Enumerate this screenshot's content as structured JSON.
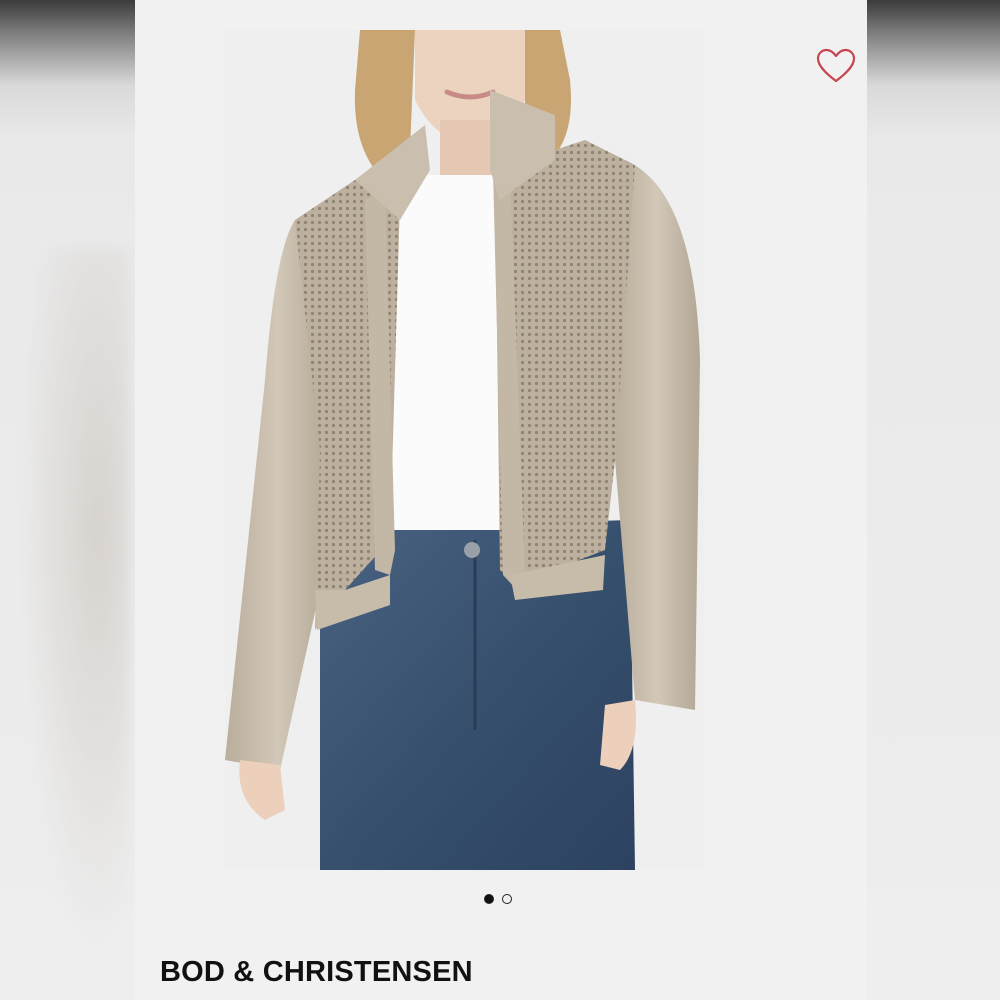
{
  "product": {
    "brand": "BOD & CHRISTENSEN",
    "image_alt": "leather jacket",
    "wishlist_icon": "heart-outline-icon",
    "carousel": {
      "total": 2,
      "active_index": 0
    }
  },
  "colors": {
    "heart": "#c8444e",
    "jacket": "#c5b9a8",
    "denim": "#3d5470"
  }
}
